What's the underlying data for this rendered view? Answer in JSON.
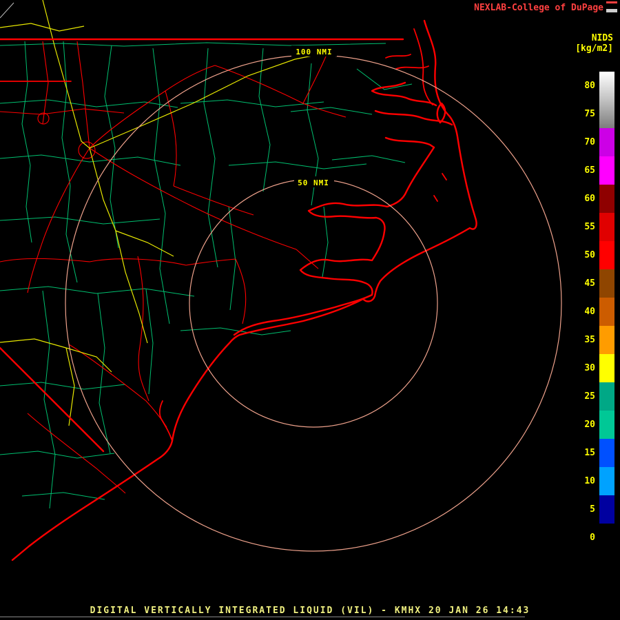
{
  "header": {
    "title": "NEXLAB-College of DuPage",
    "logo_icon": "cod-weather-logo-icon"
  },
  "colorbar": {
    "title": "NIDS",
    "units": "[kg/m2]",
    "segments": [
      {
        "label": "80",
        "color": "#ffffff",
        "color2": "#c2c2c2"
      },
      {
        "label": "75",
        "color": "#c2c2c2",
        "color2": "#7d7d7d"
      },
      {
        "label": "70",
        "color": "#cc00e6"
      },
      {
        "label": "65",
        "color": "#ff00ff"
      },
      {
        "label": "60",
        "color": "#8f0000"
      },
      {
        "label": "55",
        "color": "#e00000"
      },
      {
        "label": "50",
        "color": "#ff0000"
      },
      {
        "label": "45",
        "color": "#8f4500"
      },
      {
        "label": "40",
        "color": "#cc5c00"
      },
      {
        "label": "35",
        "color": "#ff9c00"
      },
      {
        "label": "30",
        "color": "#ffff00"
      },
      {
        "label": "25",
        "color": "#00a886"
      },
      {
        "label": "20",
        "color": "#00c896"
      },
      {
        "label": "15",
        "color": "#0050ff"
      },
      {
        "label": "10",
        "color": "#00a2ff"
      },
      {
        "label": "5",
        "color": "#0000a0"
      },
      {
        "label": "0",
        "color": "#000000"
      }
    ]
  },
  "range_rings": {
    "outer_label": "100 NMI",
    "inner_label": "50 NMI"
  },
  "footer": {
    "title": "DIGITAL VERTICALLY INTEGRATED LIQUID (VIL) - KMHX 20 JAN 26 14:43",
    "product": "DIGITAL VERTICALLY INTEGRATED LIQUID (VIL)",
    "station": "KMHX",
    "datetime": "20 JAN 26 14:43"
  },
  "colors": {
    "background": "#000000",
    "map_red": "#ff0000",
    "map_green": "#00c070",
    "map_yellow": "#e8e800",
    "ring_salmon": "#efa28c",
    "label_yellow": "#ffff00",
    "header_red": "#ff4040",
    "footer_text": "#f0f080",
    "footer_line": "#8a8a8a"
  }
}
